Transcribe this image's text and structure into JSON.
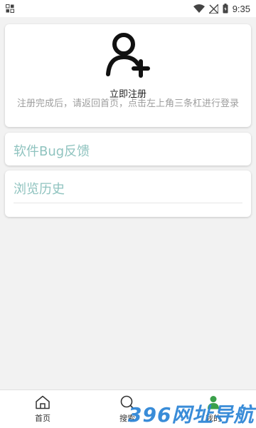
{
  "status_bar": {
    "time": "9:35",
    "icons": [
      "gallery-icon",
      "wifi-icon",
      "no-signal-icon",
      "battery-icon"
    ]
  },
  "profile": {
    "avatar_icon": "user-add-icon",
    "register_label": "立即注册",
    "hint": "注册完成后，请返回首页，点击左上角三条杠进行登录"
  },
  "menu": {
    "feedback": "软件Bug反馈",
    "history": "浏览历史"
  },
  "tabs": [
    {
      "label": "首页",
      "icon": "home-icon"
    },
    {
      "label": "搜索",
      "icon": "search-icon"
    },
    {
      "label": "我的",
      "icon": "user-icon"
    }
  ],
  "watermark": "396网址导航",
  "colors": {
    "accent": "#8fc3bf",
    "hint": "#9e9e9e",
    "watermark": "#2f86d6",
    "tab_active": "#3aa04a"
  }
}
